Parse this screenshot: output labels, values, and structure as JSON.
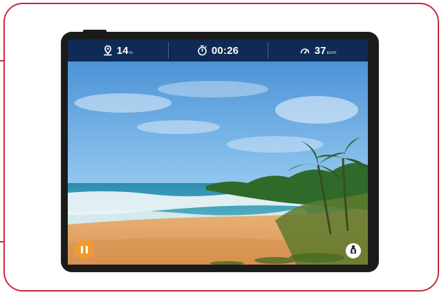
{
  "stats": {
    "distance": {
      "value": "14",
      "unit": "m",
      "icon": "location-pin-icon"
    },
    "time": {
      "value": "00:26",
      "icon": "stopwatch-icon"
    },
    "speed": {
      "value": "37",
      "unit": "km/h",
      "icon": "speedometer-icon"
    }
  },
  "controls": {
    "pause": {
      "icon": "pause-icon",
      "color": "#f29a2e"
    },
    "trainer": {
      "icon": "person-icon"
    }
  },
  "colors": {
    "accent_outline": "#c8283d",
    "status_bar": "#0f2a54"
  }
}
